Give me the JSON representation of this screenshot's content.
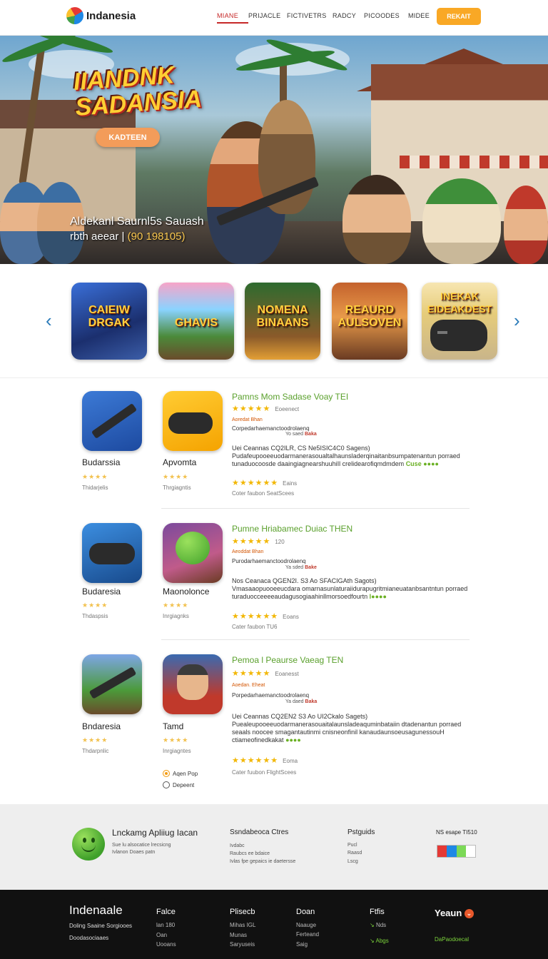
{
  "header": {
    "brand": "Indanesia",
    "nav": [
      "MIANE",
      "PRIJACLE",
      "FICTIVETRS",
      "RADCY",
      "PICOODES",
      "MIDEE"
    ],
    "cta": "REKAIT",
    "colors": {
      "accent": "#c62828",
      "cta": "#f9a825"
    }
  },
  "hero": {
    "title": "IIANDNK SADANSIA",
    "button": "KADTEEN",
    "sub1": "Aldekanl Saurnl5s Sauash",
    "sub2_pre": "rbth aeear |",
    "sub2_hl": "(90 198105)"
  },
  "carousel": {
    "tiles": [
      "CAIEIW DRGAK",
      "GHAVIS",
      "NOMENA BINAANS",
      "REAURD AULSOVEN",
      "INEKAK EIDEAKDEST"
    ]
  },
  "apps": [
    {
      "name": "Budarssia",
      "stars": "★★★★",
      "sub": "Thidarjelis"
    },
    {
      "name": "Apvomta",
      "stars": "★★★★",
      "sub": "Thrgiagntis"
    },
    {
      "name": "Budaresia",
      "stars": "★★★★",
      "sub": "Thdaspsis"
    },
    {
      "name": "Maonolonce",
      "stars": "★★★★",
      "sub": "Inrgiagnks"
    },
    {
      "name": "Bndaresia",
      "stars": "★★★★",
      "sub": "Thdarpnlic"
    },
    {
      "name": "Tamd",
      "stars": "★★★★",
      "sub": "Inrgiagntes"
    }
  ],
  "rows": [
    {
      "title": "Pamns Mom Sadase Voay TEI",
      "stars": "★★★★★",
      "count": "Eoeenect",
      "tag": "Aoredat Bhan",
      "line1": "Corpedarhaemanctoodrolaenq",
      "line2_a": "Yo saed",
      "line2_b": "Baka",
      "desc1": "Uei Ceannas  CQ2ILR, CS  Ne5ISIC4C0 Sagens)",
      "desc2": "Pudafeupooeeuodarmanerasoualtalhaunsladerqinaitanbsumpatenantun porraed",
      "desc3a": "tunaduocoosde daaingiagnearshuuhiIl crelidearofiqmdmdem",
      "desc3b": "Cuse ●●●●",
      "stars2": "★★★★★★",
      "count2": "Eains",
      "foot": "Coter faubon SeatScees"
    },
    {
      "title": "Pumne Hriabamec Duiac THEN",
      "stars": "★★★★★",
      "count": "120",
      "tag": "Aeoddat Bhan",
      "line1": "Purodarhaemanctoodrolaenq",
      "line2_a": "Ya sded",
      "line2_b": "Bake",
      "desc1": "Nos Ceanaca  QGEN2I. S3  Ao SFACIGAth Sagots)",
      "desc2": "Vmasaaopuooeeucdara omarnasunlaturaiidurapugritmianeuatanbsantntun porraed",
      "desc3a": "turaduocceeeeaudagusogiaahinllmorsoedfourtn",
      "desc3b": "I●●●●",
      "stars2": "★★★★★★",
      "count2": "Eoans",
      "foot": "Cater faubon TU6"
    },
    {
      "title": "Pemoa l Peaurse Vaeag TEN",
      "stars": "★★★★★",
      "count": "Eoanesst",
      "tag": "Aoedan. Eheat",
      "line1": "Porpedarhaemanctoodrolaenq",
      "line2_a": "Ya daed",
      "line2_b": "Baka",
      "desc1": "Uei Ceannas  CQ2EN2 S3  Ao UI2Ckalo Sagets)",
      "desc2": "Puealeupooeeuodarmanerasouaitalaunsladeaquminbataiin dtadenantun porraed",
      "desc3a": "seaals noocee smagantautinmi cnisneonfinil kanaudaunsoeusagunessouH  ctiameofinedkakat",
      "desc3b": "●●●●",
      "stars2": "★★★★★★",
      "count2": "Eoma",
      "foot": "Cater fuubon FlightScees"
    }
  ],
  "radios": [
    {
      "label": "Aqen Pop",
      "checked": true
    },
    {
      "label": "Depeent",
      "checked": false
    }
  ],
  "prefooter": {
    "title": "Lnckamg Apliiug Iacan",
    "text1": "Sue lu alsocatice lrecsicng",
    "text2": "Ivlanon Doaes patn",
    "col1": {
      "h": "Ssndabeoca Ctres",
      "t": [
        "Ivdabc",
        "Raubcs ee bdaice",
        "Ivlas fpe gepaics ie daetersse"
      ]
    },
    "col2": {
      "h": "Pstguids",
      "t": [
        "Pucl",
        "Raasd",
        "Lscg"
      ]
    },
    "col3": {
      "h": "NS esape TI510"
    },
    "flag_colors": [
      "#e53935",
      "#1e88e5",
      "#7cd957",
      "#ffffff"
    ]
  },
  "footer": {
    "brand": "Indenaale",
    "brand_t1": "Doling Saaine Sorgiooes",
    "brand_t2": "Doodasociaaes",
    "cols": [
      {
        "h": "Falce",
        "t": [
          "lan 180",
          "Oan",
          "Uooans"
        ]
      },
      {
        "h": "Plisecb",
        "t": [
          "Mihas IGL",
          "Munas",
          "Saryuseis"
        ]
      },
      {
        "h": "Doan",
        "t": [
          "Naauge",
          "Ferteand",
          "Saig"
        ]
      },
      {
        "h": "Ftfis",
        "t": [
          "Nds",
          "Abgs"
        ]
      }
    ],
    "yeaun": "Yeaun",
    "yeaun_sub": "DaPaodoecal"
  }
}
